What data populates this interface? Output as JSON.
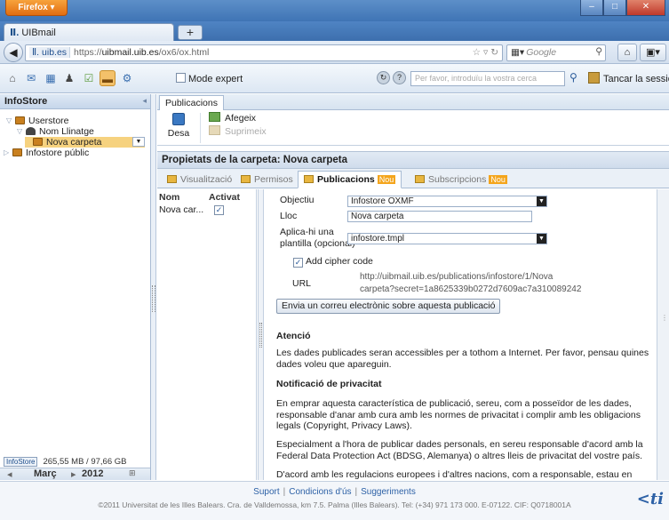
{
  "browser": {
    "menu_button": "Firefox",
    "tab_title": "UIBmail",
    "url_site": "uib.es",
    "url_proto": "https://",
    "url_host": "uibmail.uib.es",
    "url_path": "/ox6/ox.html",
    "search_placeholder": "Google"
  },
  "toolbar": {
    "mode_expert": "Mode expert",
    "search_placeholder": "Per favor, introduïu la vostra cerca",
    "logout": "Tancar la sessió"
  },
  "left": {
    "header": "InfoStore",
    "tree": [
      {
        "label": "Userstore"
      },
      {
        "label": "Nom Llinatge"
      },
      {
        "label": "Nova carpeta"
      },
      {
        "label": "Infostore públic"
      }
    ],
    "quota_button": "InfoStore",
    "quota": "265,55 MB / 97,66 GB",
    "cal_month": "Març",
    "cal_year": "2012"
  },
  "ribbon": {
    "tab": "Publicacions",
    "save": "Desa",
    "add": "Afegeix",
    "delete": "Suprimeix"
  },
  "panel": {
    "title": "Propietats de la carpeta: Nova carpeta",
    "tabs": [
      {
        "label": "Visualització"
      },
      {
        "label": "Permisos"
      },
      {
        "label": "Publicacions",
        "badge": "Nou"
      },
      {
        "label": "Subscripcions",
        "badge": "Nou"
      }
    ]
  },
  "publist": {
    "col_name": "Nom",
    "col_active": "Activat",
    "rows": [
      {
        "name": "Nova car...",
        "active": true
      }
    ]
  },
  "form": {
    "objective_label": "Objectiu",
    "objective_value": "Infostore OXMF",
    "place_label": "Lloc",
    "place_value": "Nova carpeta",
    "template_label_1": "Aplica-hi una",
    "template_label_2": "plantilla (opcional)",
    "template_value": "infostore.tmpl",
    "cipher_label": "Add cipher code",
    "url_label": "URL",
    "url_line1": "http://uibmail.uib.es/publications/infostore/1/Nova",
    "url_line2": "carpeta?secret=1a8625339b0272d7609ac7a310089242",
    "email_button": "Envia un correu electrònic sobre aquesta publicació",
    "attention_heading": "Atenció",
    "attention_text": "Les dades publicades seran accessibles per a tothom a Internet. Per favor, pensau quines dades voleu que apareguin.",
    "privacy_heading": "Notificació de privacitat",
    "privacy_p1": "En emprar aquesta característica de publicació, sereu, com a posseïdor de les dades, responsable d'anar amb cura amb les normes de privacitat i complir amb les obligacions legals (Copyright, Privacy Laws).",
    "privacy_p2": "Especialment a l'hora de publicar dades personals, en sereu responsable d'acord amb la Federal Data Protection Act (BDSG, Alemanya) o altres lleis de privacitat del vostre país.",
    "privacy_p3": "D'acord amb les regulacions europees i d'altres nacions, com a responsable, estau en càrrec de"
  },
  "footer": {
    "support": "Suport",
    "terms": "Condicions d'ús",
    "suggestions": "Suggeriments",
    "copyright": "©2011 Universitat de les Illes Balears. Cra. de Valldemossa, km 7.5. Palma (Illes Balears). Tel: (+34) 971 173 000. E-07122. CIF: Q0718001A",
    "logo": "ti"
  }
}
